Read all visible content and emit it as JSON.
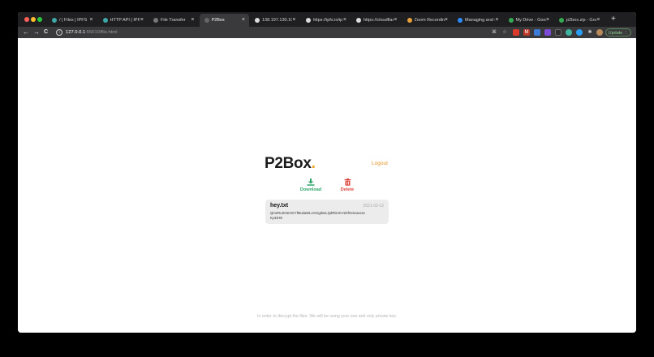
{
  "browser": {
    "tabs": [
      {
        "label": "/ | Files | IPFS",
        "icon": "ipfs-icon",
        "color": "#3ea7a8",
        "active": false
      },
      {
        "label": "HTTP API | IPFS",
        "icon": "ipfs-icon",
        "color": "#3ea7a8",
        "active": false
      },
      {
        "label": "File Transfer",
        "icon": "loading-icon",
        "color": "#777777",
        "active": false
      },
      {
        "label": "P2Box",
        "icon": "globe-icon",
        "color": "#666666",
        "active": true
      },
      {
        "label": "138.197.130.10",
        "icon": "globe-icon",
        "color": "#dddddd",
        "active": false
      },
      {
        "label": "https://ipfs.io/ip",
        "icon": "globe-icon",
        "color": "#dddddd",
        "active": false
      },
      {
        "label": "https://cloudflar",
        "icon": "globe-icon",
        "color": "#dddddd",
        "active": false
      },
      {
        "label": "Zoom Recording",
        "icon": "zoom-icon",
        "color": "#e8a23c",
        "active": false
      },
      {
        "label": "Managing and u",
        "icon": "docs-icon",
        "color": "#2d8cff",
        "active": false
      },
      {
        "label": "My Drive - Goog",
        "icon": "drive-icon",
        "color": "#34a853",
        "active": false
      },
      {
        "label": "p2box.zip - Goo",
        "icon": "drive-icon",
        "color": "#34a853",
        "active": false
      }
    ],
    "close_glyph": "×",
    "newtab_glyph": "+",
    "nav": {
      "back": "←",
      "forward": "→",
      "reload": "C"
    },
    "url_host": "127.0.0.1",
    "url_rest": ":55010/file.html",
    "update_label": "Update",
    "info_glyph": "i"
  },
  "app": {
    "logo_text": "P2Box",
    "logo_dot": ".",
    "logout_label": "Logout",
    "download_label": "Download",
    "delete_label": "Delete",
    "file": {
      "name": "hey.txt",
      "date": "2021-02-12",
      "hash": "QmeRcJKNrHGYfMudaWLvrvGgdseLQdRDAKVZ4fXescaecsc\nKy4zHE"
    },
    "footer_text": "In order to decrypt the files. We will be using your one and only private key."
  },
  "colors": {
    "accent": "#f2a31b",
    "download": "#2fa66c",
    "delete": "#e0453d",
    "card_bg": "#ececec"
  }
}
